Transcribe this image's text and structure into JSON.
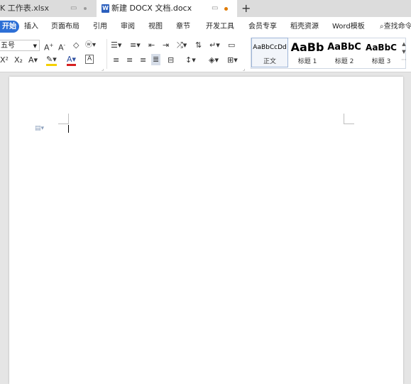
{
  "tabs": [
    {
      "label": "K 工作表.xlsx",
      "active": false
    },
    {
      "label": "新建 DOCX 文档.docx",
      "active": true
    }
  ],
  "new_tab_label": "+",
  "doc_icon_letter": "W",
  "menu": {
    "items": [
      "开始",
      "插入",
      "页面布局",
      "引用",
      "审阅",
      "视图",
      "章节",
      "开发工具",
      "会员专享",
      "稻壳资源",
      "Word模板"
    ],
    "search_label": "查找命令"
  },
  "ribbon": {
    "font_size": "五号",
    "styles": [
      {
        "preview": "AaBbCcDd",
        "name": "正文"
      },
      {
        "preview": "AaBb",
        "name": "标题 1"
      },
      {
        "preview": "AaBbC",
        "name": "标题 2"
      },
      {
        "preview": "AaBbC",
        "name": "标题 3"
      }
    ]
  },
  "colors": {
    "accent": "#2d6fd6",
    "highlight": "#f5d000",
    "font_color": "#d62020",
    "unsaved_dot": "#e07b00"
  }
}
